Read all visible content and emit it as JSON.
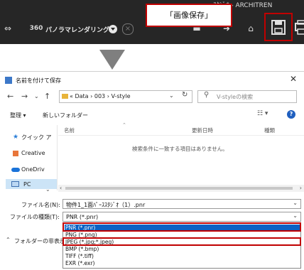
{
  "app": {
    "title_fragment": "ｽﾀｼﾞｵ - ARCHITREN",
    "toolbar": {
      "mode_label": "パノラマレンダリング"
    },
    "callout_text": "「画像保存」"
  },
  "dialog": {
    "title": "名前を付けて保存",
    "breadcrumb": [
      "«",
      "Data",
      "›",
      "003",
      "›",
      "V-style"
    ],
    "search_placeholder": "V-styleの検索",
    "organize_label": "整理 ▾",
    "new_folder_label": "新しいフォルダー",
    "columns": [
      "名前",
      "更新日時",
      "種類"
    ],
    "empty_message": "検索条件に一致する項目はありません。",
    "sidebar_items": [
      "クイック ア",
      "Creative",
      "OneDriv",
      "PC"
    ],
    "filename_label": "ファイル名(N):",
    "filename_value": "物件1_1面ﾊﾟｰｽｽﾀｼﾞｵ（1）.pnr",
    "filetype_label": "ファイルの種類(T):",
    "filetype_value": "PNR (*.pnr)",
    "hide_folders_label": "フォルダーの非表示",
    "filetype_options": [
      "PNR (*.pnr)",
      "PNG (*.png)",
      "JPEG (*.jpg;*.jpeg)",
      "BMP (*.bmp)",
      "TIFF (*.tiff)",
      "EXR (*.exr)"
    ],
    "selected_option_index": 0
  },
  "colors": {
    "toolbar_bg": "#262626",
    "highlight_red": "#c00000",
    "selection_blue": "#0b62c4"
  }
}
